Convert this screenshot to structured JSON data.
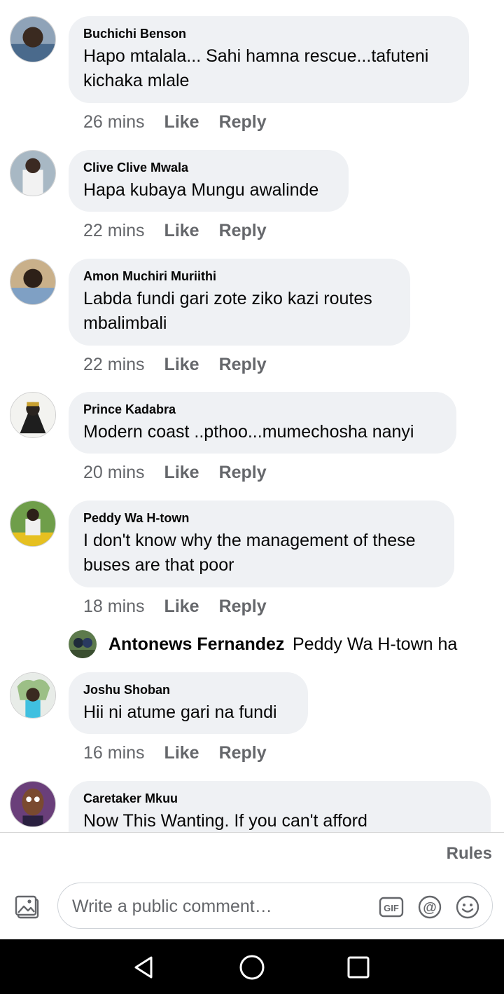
{
  "comments": [
    {
      "author": "Buchichi Benson",
      "text": "Hapo mtalala... Sahi hamna rescue...tafuteni kichaka mlale",
      "time": "26 mins",
      "like": "Like",
      "reply": "Reply"
    },
    {
      "author": "Clive Clive Mwala",
      "text": "Hapa kubaya Mungu awalinde",
      "time": "22 mins",
      "like": "Like",
      "reply": "Reply"
    },
    {
      "author": "Amon Muchiri Muriithi",
      "text": "Labda fundi gari zote ziko kazi routes mbalimbali",
      "time": "22 mins",
      "like": "Like",
      "reply": "Reply"
    },
    {
      "author": "Prince Kadabra",
      "text": "Modern coast ..pthoo...mumechosha nanyi",
      "time": "20 mins",
      "like": "Like",
      "reply": "Reply"
    },
    {
      "author": "Peddy Wa H-town",
      "text": "I don't know why the management of these buses are that poor",
      "time": "18 mins",
      "like": "Like",
      "reply": "Reply"
    },
    {
      "author": "Joshu Shoban",
      "text": "Hii ni atume gari na fundi",
      "time": "16 mins",
      "like": "Like",
      "reply": "Reply"
    },
    {
      "author": "Caretaker Mkuu",
      "text": "Now This Wanting. If you can't afford"
    }
  ],
  "reply_preview": {
    "author": "Antonews Fernandez",
    "text": "Peddy Wa H-town ha"
  },
  "rules_label": "Rules",
  "composer": {
    "placeholder": "Write a public comment…"
  },
  "icons": {
    "photo": "photo-icon",
    "gif": "gif-icon",
    "mention": "mention-icon",
    "emoji": "emoji-icon",
    "back": "back-nav-icon",
    "home": "home-nav-icon",
    "recents": "recents-nav-icon"
  },
  "colors": {
    "bubble": "#eff1f4",
    "muted": "#65676b",
    "text": "#050505",
    "navbar": "#000000"
  }
}
